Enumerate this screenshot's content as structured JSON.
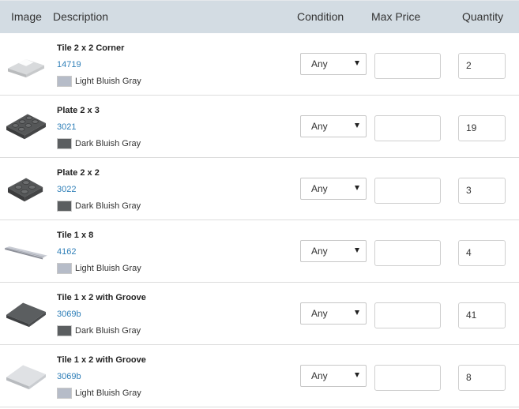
{
  "header": {
    "image": "Image",
    "description": "Description",
    "condition": "Condition",
    "max_price": "Max Price",
    "quantity": "Quantity"
  },
  "colors": {
    "Light Bluish Gray": "#b6bcc8",
    "Dark Bluish Gray": "#5b5e60"
  },
  "items": [
    {
      "name": "Tile 2 x 2 Corner",
      "part": "14719",
      "color": "Light Bluish Gray",
      "condition": "Any",
      "max_price": "",
      "quantity": "2",
      "icon": "tile-corner-icon"
    },
    {
      "name": "Plate 2 x 3",
      "part": "3021",
      "color": "Dark Bluish Gray",
      "condition": "Any",
      "max_price": "",
      "quantity": "19",
      "icon": "plate-2x3-icon"
    },
    {
      "name": "Plate 2 x 2",
      "part": "3022",
      "color": "Dark Bluish Gray",
      "condition": "Any",
      "max_price": "",
      "quantity": "3",
      "icon": "plate-2x2-icon"
    },
    {
      "name": "Tile 1 x 8",
      "part": "4162",
      "color": "Light Bluish Gray",
      "condition": "Any",
      "max_price": "",
      "quantity": "4",
      "icon": "tile-1x8-icon"
    },
    {
      "name": "Tile 1 x 2 with Groove",
      "part": "3069b",
      "color": "Dark Bluish Gray",
      "condition": "Any",
      "max_price": "",
      "quantity": "41",
      "icon": "tile-1x2-icon"
    },
    {
      "name": "Tile 1 x 2 with Groove",
      "part": "3069b",
      "color": "Light Bluish Gray",
      "condition": "Any",
      "max_price": "",
      "quantity": "8",
      "icon": "tile-1x2-icon"
    }
  ]
}
